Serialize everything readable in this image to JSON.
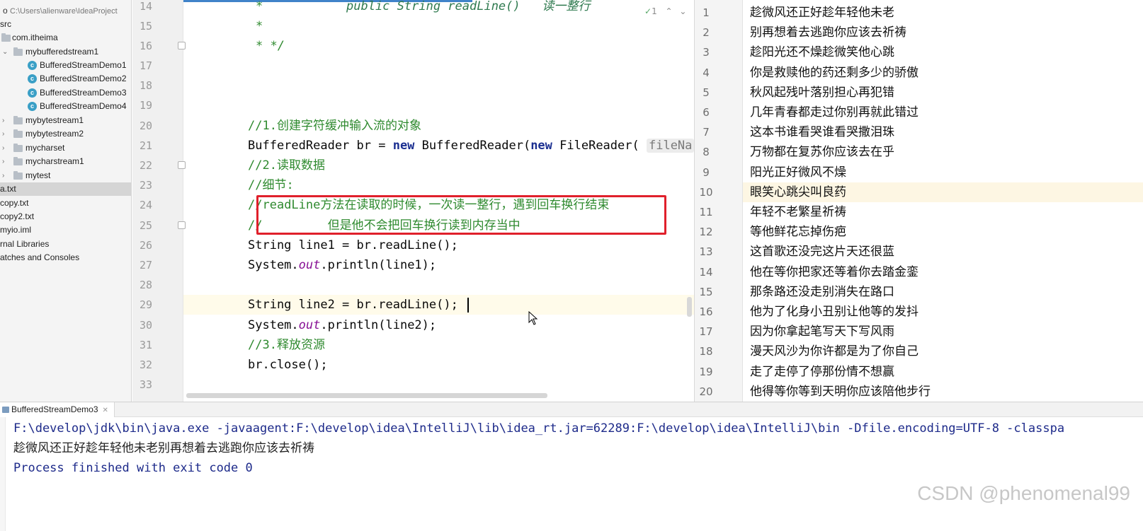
{
  "tree": {
    "path_row": "C:\\Users\\alienware\\IdeaProject",
    "items": [
      {
        "label": "src"
      },
      {
        "label": "com.itheima"
      },
      {
        "label": "mybufferedstream1"
      },
      {
        "label": "BufferedStreamDemo1"
      },
      {
        "label": "BufferedStreamDemo2"
      },
      {
        "label": "BufferedStreamDemo3"
      },
      {
        "label": "BufferedStreamDemo4"
      },
      {
        "label": "mybytestream1"
      },
      {
        "label": "mybytestream2"
      },
      {
        "label": "mycharset"
      },
      {
        "label": "mycharstream1"
      },
      {
        "label": "mytest"
      },
      {
        "label": "a.txt"
      },
      {
        "label": "copy.txt"
      },
      {
        "label": "copy2.txt"
      },
      {
        "label": "myio.iml"
      },
      {
        "label": "rnal Libraries"
      },
      {
        "label": "atches and Consoles"
      }
    ]
  },
  "editor": {
    "warning_count": "1",
    "line_numbers": [
      "14",
      "15",
      "16",
      "17",
      "18",
      "19",
      "20",
      "21",
      "22",
      "23",
      "24",
      "25",
      "26",
      "27",
      "28",
      "29",
      "30",
      "31",
      "32",
      "33"
    ],
    "lines": {
      "l14a": "*",
      "l14b": "public String readLine()   读一整行",
      "l15": "*",
      "l16": "* */",
      "l20": "//1.创建字符缓冲输入流的对象",
      "l21_pre": "BufferedReader br = ",
      "l21_new1": "new",
      "l21_mid": " BufferedReader(",
      "l21_new2": "new",
      "l21_post": " FileReader(",
      "l21_hint": "fileNa",
      "l22": "//2.读取数据",
      "l23": "//细节:",
      "l24_slash": "/",
      "l24_code": "/readLine",
      "l24_text": "方法在读取的时候，一次读一整行，遇到回车换行结束",
      "l25_slash": "//",
      "l25_text": "但是他不会把回车换行读到内存当中",
      "l26": "String line1 = br.readLine();",
      "l27_pre": "System.",
      "l27_field": "out",
      "l27_post": ".println(line1);",
      "l29": "String line2 = br.readLine();",
      "l30_pre": "System.",
      "l30_field": "out",
      "l30_post": ".println(line2);",
      "l31": "//3.释放资源",
      "l32": "br.close();"
    }
  },
  "viewer": {
    "lines": [
      {
        "n": "1",
        "text": "趁微风还正好趁年轻他未老"
      },
      {
        "n": "2",
        "text": "别再想着去逃跑你应该去祈祷"
      },
      {
        "n": "3",
        "text": "趁阳光还不燥趁微笑他心跳"
      },
      {
        "n": "4",
        "text": "你是救赎他的药还剩多少的骄傲"
      },
      {
        "n": "5",
        "text": "秋风起残叶落别担心再犯错"
      },
      {
        "n": "6",
        "text": "几年青春都走过你别再就此错过"
      },
      {
        "n": "7",
        "text": "这本书谁看哭谁看哭撒泪珠"
      },
      {
        "n": "8",
        "text": "万物都在复苏你应该去在乎"
      },
      {
        "n": "9",
        "text": "阳光正好微风不燥"
      },
      {
        "n": "10",
        "text": "眼笑心跳尖叫良药"
      },
      {
        "n": "11",
        "text": "年轻不老繁星祈祷"
      },
      {
        "n": "12",
        "text": "等他鲜花忘掉伤疤"
      },
      {
        "n": "13",
        "text": "这首歌还没完这片天还很蓝"
      },
      {
        "n": "14",
        "text": "他在等你把家还等着你去踏金銮"
      },
      {
        "n": "15",
        "text": "那条路还没走别消失在路口"
      },
      {
        "n": "16",
        "text": "他为了化身小丑别让他等的发抖"
      },
      {
        "n": "17",
        "text": "因为你拿起笔写天下写风雨"
      },
      {
        "n": "18",
        "text": "漫天风沙为你许都是为了你自己"
      },
      {
        "n": "19",
        "text": "走了走停了停那份情不想赢"
      },
      {
        "n": "20",
        "text": "他得等你等到天明你应该陪他步行"
      }
    ]
  },
  "run": {
    "tab_label": "BufferedStreamDemo3",
    "cmd": "F:\\develop\\jdk\\bin\\java.exe -javaagent:F:\\develop\\idea\\IntelliJ\\lib\\idea_rt.jar=62289:F:\\develop\\idea\\IntelliJ\\bin -Dfile.encoding=UTF-8 -classpa",
    "output": "趁微风还正好趁年轻他未老别再想着去逃跑你应该去祈祷",
    "exit": "Process finished with exit code 0"
  },
  "watermark": "CSDN @phenomenal99"
}
